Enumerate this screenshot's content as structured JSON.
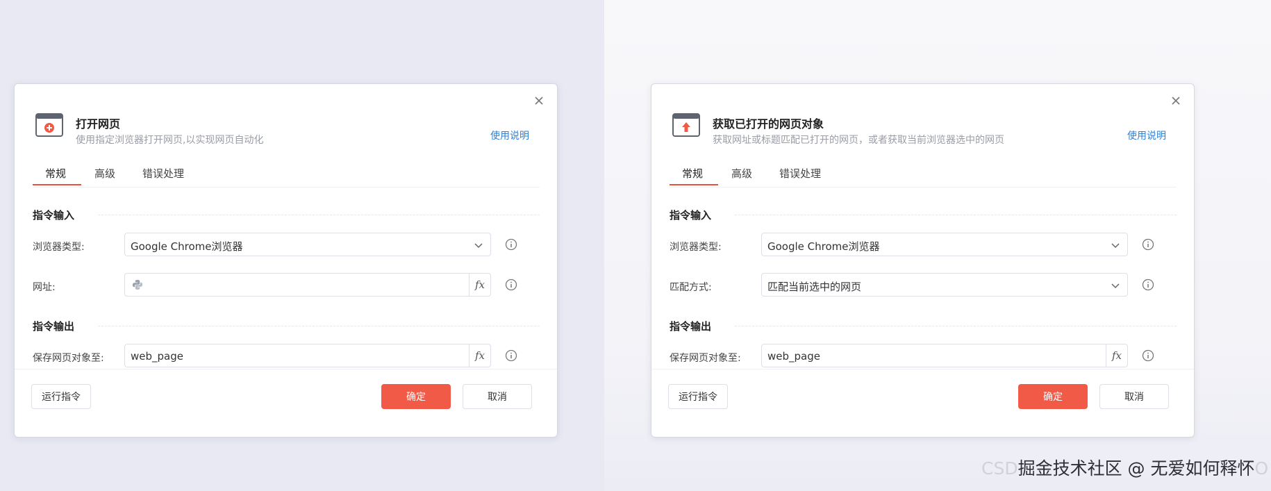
{
  "dialogs": [
    {
      "title": "打开网页",
      "subtitle": "使用指定浏览器打开网页,以实现网页自动化",
      "help": "使用说明",
      "tabs": [
        "常规",
        "高级",
        "错误处理"
      ],
      "input_section": "指令输入",
      "output_section": "指令输出",
      "fields": [
        {
          "label": "浏览器类型:",
          "value": "Google Chrome浏览器"
        },
        {
          "label": "网址:",
          "value": ""
        },
        {
          "label": "保存网页对象至:",
          "value": "web_page"
        }
      ],
      "buttons": {
        "run": "运行指令",
        "ok": "确定",
        "cancel": "取消"
      },
      "fx": "fx"
    },
    {
      "title": "获取已打开的网页对象",
      "subtitle": "获取网址或标题匹配已打开的网页，或者获取当前浏览器选中的网页",
      "help": "使用说明",
      "tabs": [
        "常规",
        "高级",
        "错误处理"
      ],
      "input_section": "指令输入",
      "output_section": "指令输出",
      "fields": [
        {
          "label": "浏览器类型:",
          "value": "Google Chrome浏览器"
        },
        {
          "label": "匹配方式:",
          "value": "匹配当前选中的网页"
        },
        {
          "label": "保存网页对象至:",
          "value": "web_page"
        }
      ],
      "buttons": {
        "run": "运行指令",
        "ok": "确定",
        "cancel": "取消"
      },
      "fx": "fx"
    }
  ],
  "watermark": {
    "faded": "CSD",
    "main": "掘金技术社区 @ 无爱如何释怀",
    "tail": "O"
  },
  "colors": {
    "accent": "#f25a48",
    "link": "#2f7fd1",
    "tab_underline": "#e8503f"
  },
  "icons": {
    "close": "close-icon",
    "open_webpage": "browser-open-icon",
    "get_webpage": "browser-upload-icon",
    "chevron": "chevron-down-icon",
    "info": "info-circle-icon",
    "python": "python-icon"
  }
}
